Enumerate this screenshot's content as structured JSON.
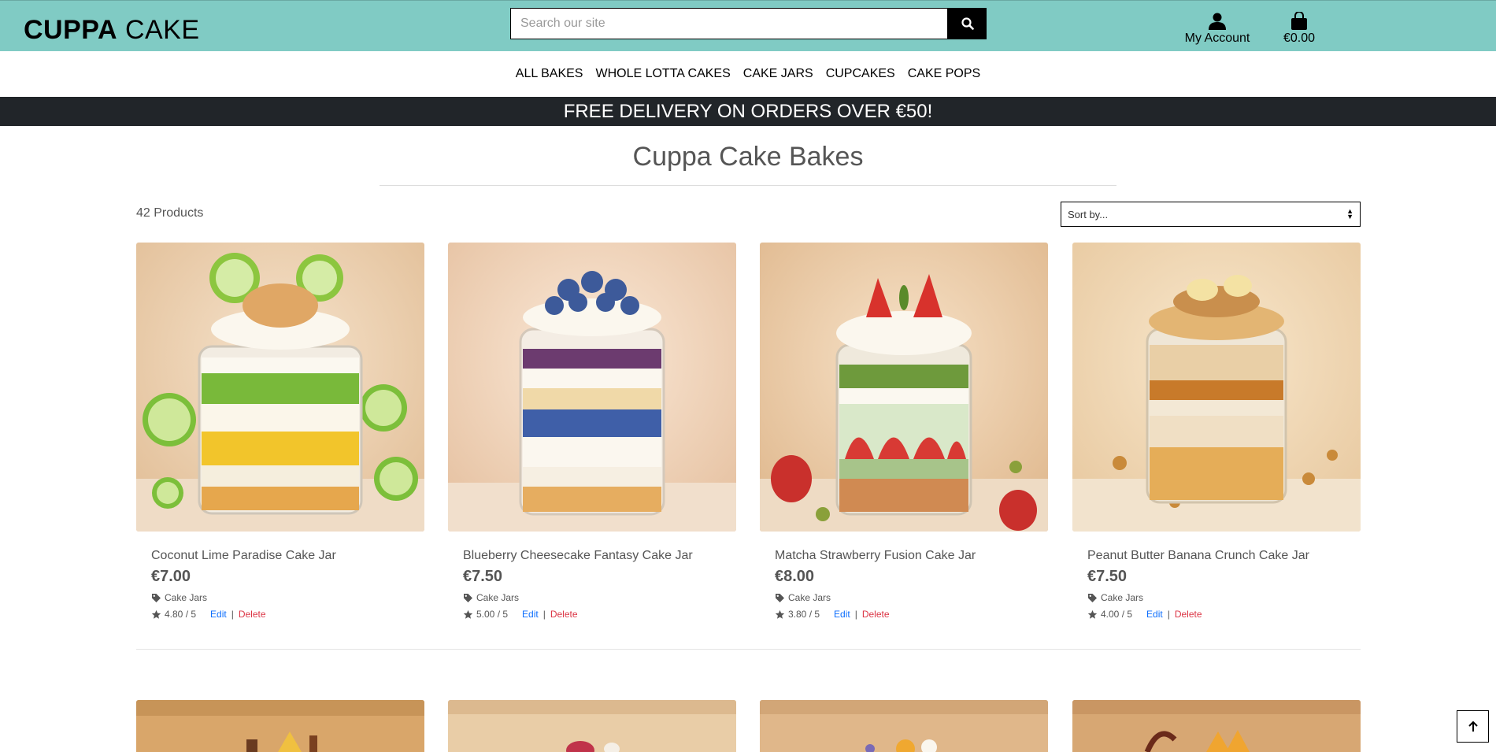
{
  "brand": {
    "bold": "CUPPA",
    "rest": " CAKE"
  },
  "search": {
    "placeholder": "Search our site",
    "value": ""
  },
  "header": {
    "account_label": "My Account",
    "bag_total": "€0.00"
  },
  "nav": [
    "ALL BAKES",
    "WHOLE LOTTA CAKES",
    "CAKE JARS",
    "CUPCAKES",
    "CAKE POPS"
  ],
  "banner": "FREE DELIVERY ON ORDERS OVER €50!",
  "page_title": "Cuppa Cake Bakes",
  "product_count": "42 Products",
  "sort": {
    "selected": "Sort by..."
  },
  "products": [
    {
      "name": "Coconut Lime Paradise Cake Jar",
      "price": "€7.00",
      "category": "Cake Jars",
      "rating": "4.80 / 5",
      "edit": "Edit",
      "sep": "|",
      "delete": "Delete"
    },
    {
      "name": "Blueberry Cheesecake Fantasy Cake Jar",
      "price": "€7.50",
      "category": "Cake Jars",
      "rating": "5.00 / 5",
      "edit": "Edit",
      "sep": "|",
      "delete": "Delete"
    },
    {
      "name": "Matcha Strawberry Fusion Cake Jar",
      "price": "€8.00",
      "category": "Cake Jars",
      "rating": "3.80 / 5",
      "edit": "Edit",
      "sep": "|",
      "delete": "Delete"
    },
    {
      "name": "Peanut Butter Banana Crunch Cake Jar",
      "price": "€7.50",
      "category": "Cake Jars",
      "rating": "4.00 / 5",
      "edit": "Edit",
      "sep": "|",
      "delete": "Delete"
    }
  ],
  "colors": {
    "header_bg": "#80cbc4",
    "banner_bg": "#212529",
    "edit_link": "#0d6efd",
    "delete_link": "#dc3545"
  },
  "icons": {
    "search": "search-icon",
    "account": "user-icon",
    "bag": "shopping-bag-icon",
    "category": "tag-icon",
    "rating": "star-icon",
    "back_to_top": "arrow-up-icon"
  }
}
